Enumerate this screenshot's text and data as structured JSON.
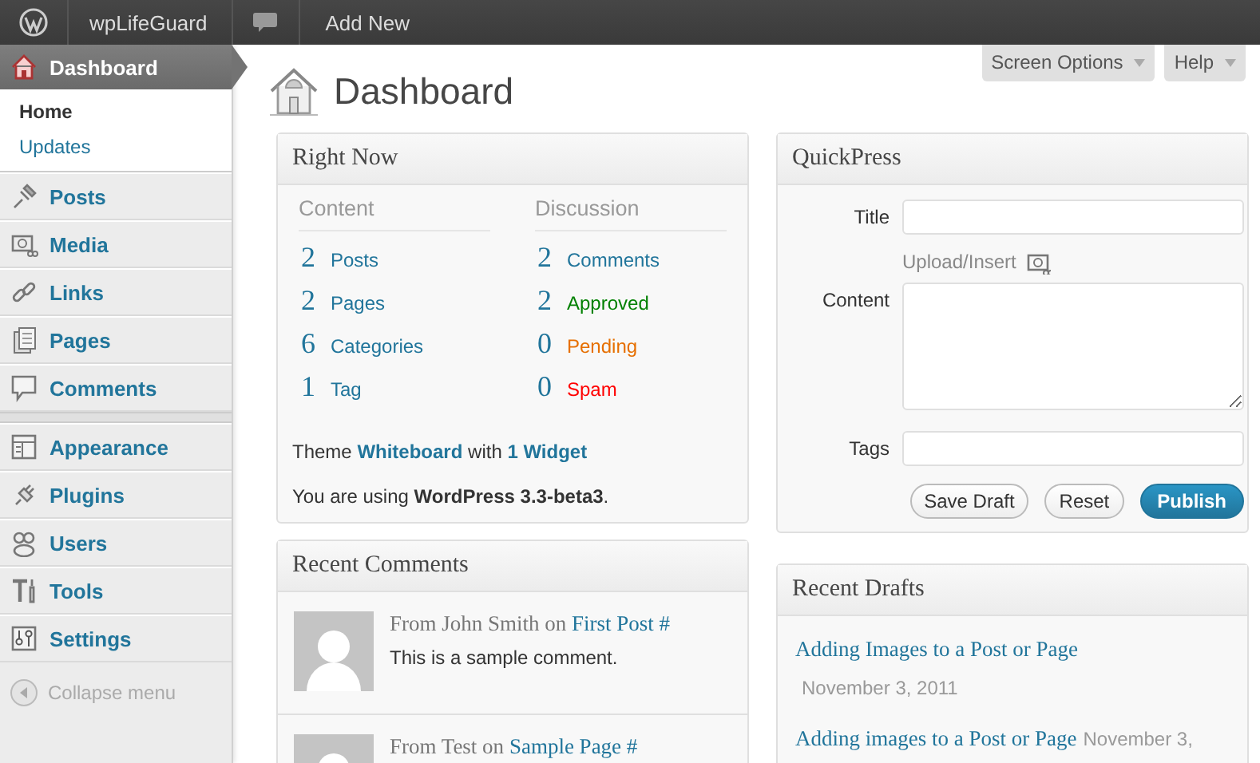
{
  "admin_bar": {
    "site_name": "wpLifeGuard",
    "add_new": "Add New"
  },
  "sidebar": {
    "groups": [
      [
        {
          "label": "Dashboard",
          "selected": true,
          "submenu": [
            {
              "label": "Home",
              "selected": true
            },
            {
              "label": "Updates",
              "selected": false
            }
          ]
        }
      ],
      [
        {
          "label": "Posts",
          "selected": false
        },
        {
          "label": "Media",
          "selected": false
        },
        {
          "label": "Links",
          "selected": false
        },
        {
          "label": "Pages",
          "selected": false
        },
        {
          "label": "Comments",
          "selected": false
        }
      ],
      [
        {
          "label": "Appearance",
          "selected": false
        },
        {
          "label": "Plugins",
          "selected": false
        },
        {
          "label": "Users",
          "selected": false
        },
        {
          "label": "Tools",
          "selected": false
        },
        {
          "label": "Settings",
          "selected": false
        }
      ]
    ],
    "collapse": "Collapse menu"
  },
  "header": {
    "title": "Dashboard",
    "tabs": [
      "Screen Options",
      "Help"
    ]
  },
  "right_now": {
    "title": "Right Now",
    "content_heading": "Content",
    "discussion_heading": "Discussion",
    "content": [
      {
        "count": "2",
        "label": "Posts"
      },
      {
        "count": "2",
        "label": "Pages"
      },
      {
        "count": "6",
        "label": "Categories"
      },
      {
        "count": "1",
        "label": "Tag"
      }
    ],
    "discussion": [
      {
        "count": "2",
        "label": "Comments",
        "color": "#21759b"
      },
      {
        "count": "2",
        "label": "Approved",
        "color": "#008000"
      },
      {
        "count": "0",
        "label": "Pending",
        "color": "#e66f00"
      },
      {
        "count": "0",
        "label": "Spam",
        "color": "#ff0000"
      }
    ],
    "theme_line": {
      "prefix": "Theme",
      "theme": "Whiteboard",
      "middle": "with",
      "widgets": "1 Widget"
    },
    "version": "You are using **WordPress 3.3-beta3**."
  },
  "quickpress": {
    "title": "QuickPress",
    "title_label": "Title",
    "upload_insert": "Upload/Insert",
    "content_label": "Content",
    "tags_label": "Tags",
    "buttons": [
      {
        "label": "Save Draft",
        "kind": "secondary"
      },
      {
        "label": "Reset",
        "kind": "secondary"
      },
      {
        "label": "Publish",
        "kind": "primary"
      }
    ]
  },
  "recent_comments": {
    "title": "Recent Comments",
    "items": [
      {
        "from": "From John Smith on",
        "post": "First Post #",
        "text": "This is a sample comment."
      },
      {
        "from": "From Test on",
        "post": "Sample Page #"
      }
    ]
  },
  "recent_drafts": {
    "title": "Recent Drafts",
    "items": [
      {
        "title": "Adding Images to a Post or Page",
        "date": "November 3, 2011"
      },
      {
        "title": "Adding images to a Post or Page",
        "date": "November 3,"
      }
    ]
  }
}
